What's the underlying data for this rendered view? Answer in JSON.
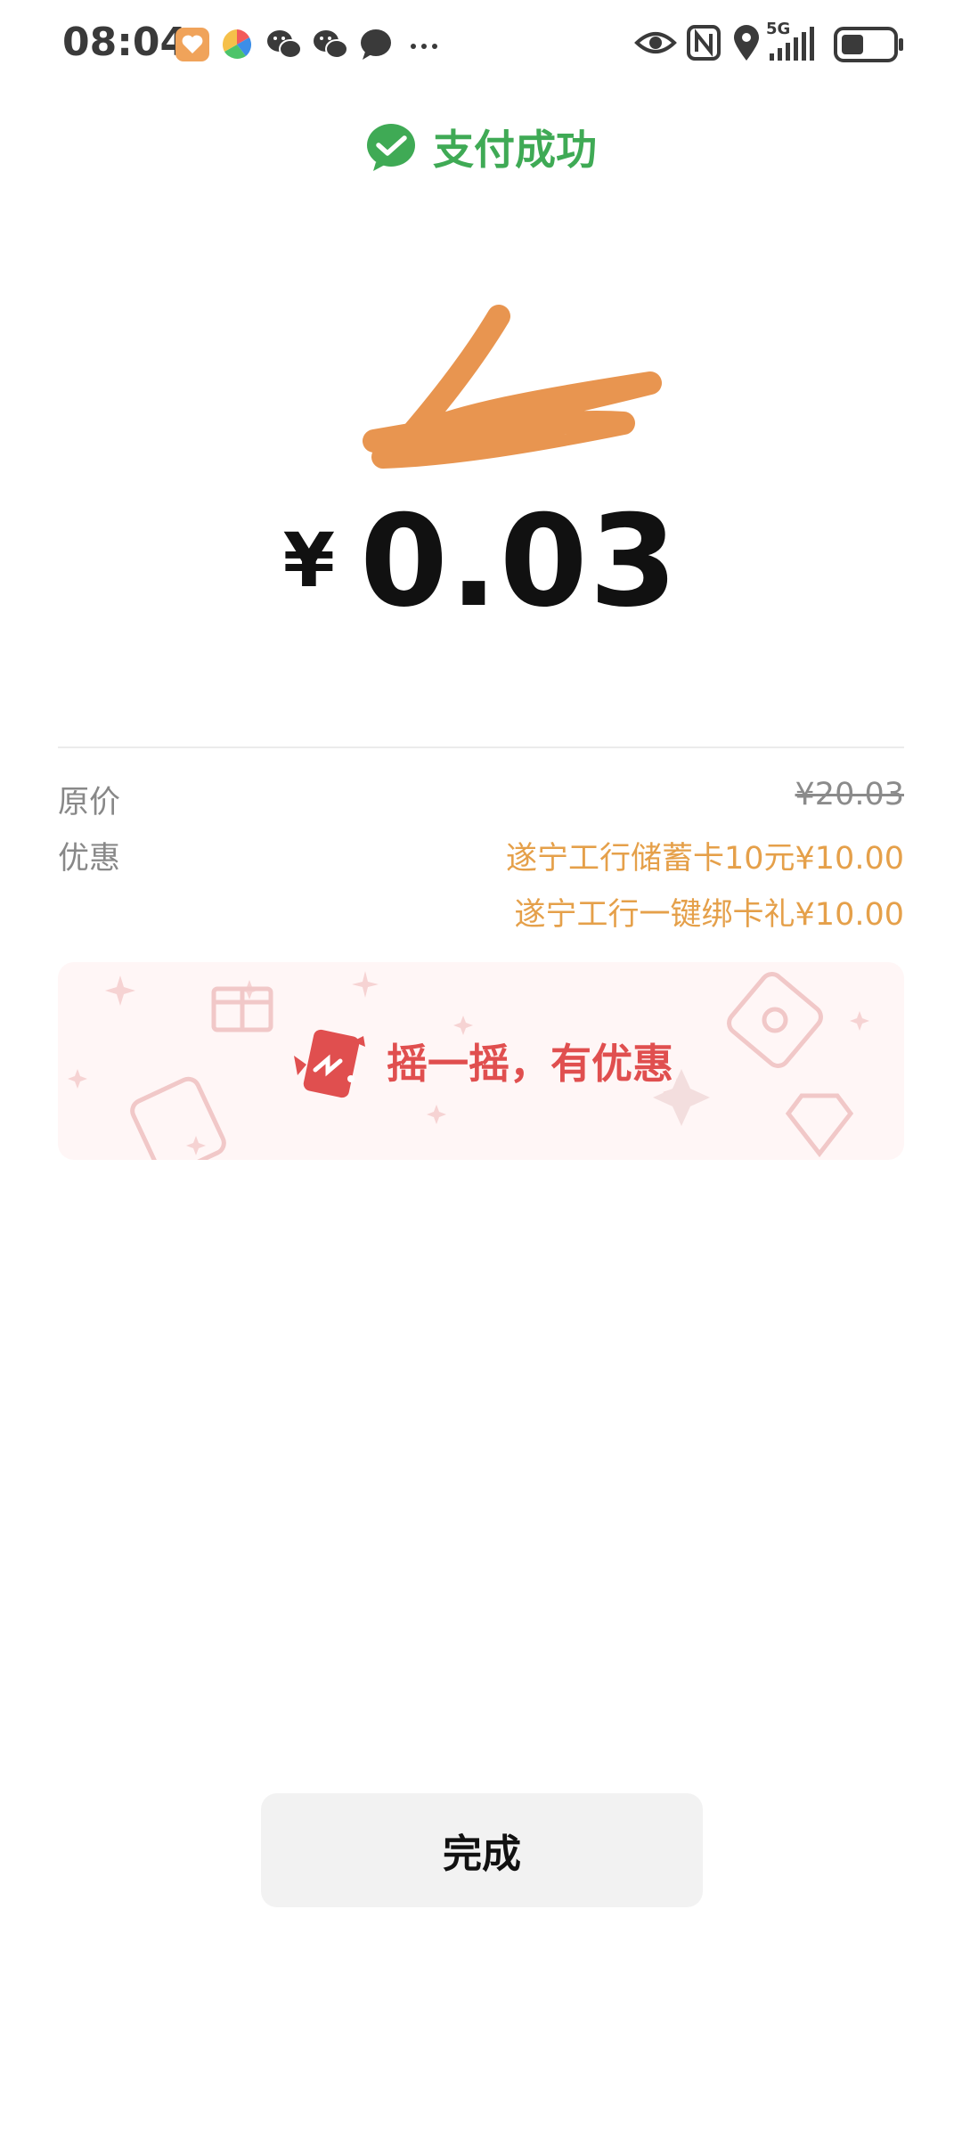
{
  "status_bar": {
    "time": "08:04",
    "notification_icons": [
      "health-app-icon",
      "pinwheel-app-icon",
      "wechat-icon",
      "wechat-icon",
      "message-icon",
      "more-dots-icon"
    ],
    "system_icons": [
      "eye-icon",
      "nfc-icon",
      "location-icon",
      "signal-5g-icon",
      "battery-icon"
    ],
    "network": "5G"
  },
  "payment": {
    "status_text": "支付成功",
    "merchant_name": "…………",
    "currency_symbol": "¥",
    "amount": "0.03"
  },
  "details": {
    "original_price_label": "原价",
    "original_price_value": "¥20.03",
    "discount_label": "优惠",
    "discounts": [
      "遂宁工行储蓄卡10元¥10.00",
      "遂宁工行一键绑卡礼¥10.00"
    ]
  },
  "promo": {
    "text": "摇一摇，有优惠"
  },
  "done_button": {
    "label": "完成"
  },
  "colors": {
    "success_green": "#3faa55",
    "discount_orange": "#e5a04a",
    "promo_red": "#e04f4f",
    "scribble_orange": "#e89550"
  }
}
